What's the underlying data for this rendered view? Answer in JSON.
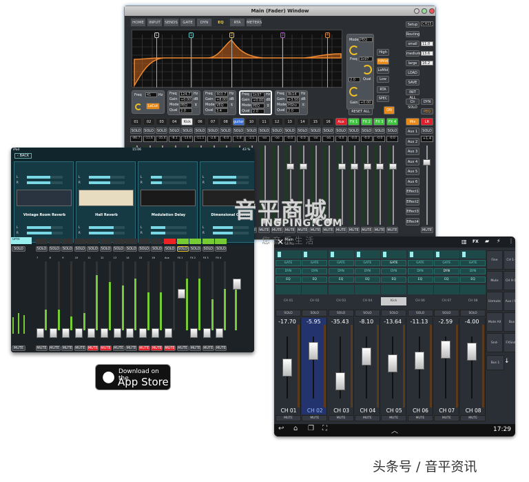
{
  "desktop": {
    "title": "Main (Fader) Window",
    "tabs": [
      "HOME",
      "INPUT",
      "SENDS",
      "GATE",
      "DYN",
      "EQ",
      "RTA",
      "METERS"
    ],
    "active_tab": "EQ",
    "band_markers": [
      "L",
      "1",
      "2",
      "3",
      "4"
    ],
    "band_marker_colors": [
      "#cccccc",
      "#5fc8c8",
      "#e0c040",
      "#b050d0",
      "#e09040"
    ],
    "eq_panel": {
      "mode_label": "Mode",
      "mode": "PEQ",
      "freq_label": "Freq",
      "freq": "1k97",
      "qual_label": "Qual",
      "qual": "2.0",
      "gain_label": "Gain",
      "gain": "+0.00"
    },
    "band_buttons": [
      "High",
      "HiMid",
      "LoMid",
      "Low"
    ],
    "active_band": "HiMid",
    "rta": "RTA",
    "spec": "SPEC",
    "reset_all": "RESET ALL",
    "on": "ON",
    "lowcut": {
      "freq_label": "Freq",
      "freq": "41",
      "unit": "Hz",
      "button": "LoCut"
    },
    "bands": [
      {
        "freq": "124.7",
        "gain": "+0.00",
        "mode": "PEQ",
        "qual": "2.0"
      },
      {
        "freq": "403.7",
        "gain": "+8.00",
        "mode": "VEQ",
        "qual": "3.4"
      },
      {
        "freq": "1k97",
        "gain": "+0.00",
        "mode": "PEQ",
        "qual": "2.0"
      },
      {
        "freq": "8k14",
        "gain": "+3.50",
        "mode": "HShv",
        "qual": "2.0"
      }
    ],
    "band_labels": {
      "freq": "Freq",
      "gain": "Gain",
      "mode": "Mode",
      "qual": "Qual",
      "hz": "Hz",
      "db": "dB",
      "b": "B"
    },
    "setup": {
      "setup": "Setup",
      "ch": "CH15",
      "routing": "Routing",
      "small": "small",
      "small_v": "11.0",
      "medium": "medium",
      "medium_v": "13.6",
      "large": "large",
      "large_v": "16.2",
      "load": "LOAD",
      "save": "SAVE",
      "init": "INIT ALL",
      "clr_solo": "Clr SOLO",
      "dyn": "DYN",
      "peq": "PEQ",
      "mix": "Mix",
      "lr": "LR"
    },
    "channels": [
      {
        "name": "01",
        "value": "-86.7",
        "fader": 0.2
      },
      {
        "name": "02",
        "value": "-11.6",
        "fader": 0.2
      },
      {
        "name": "03",
        "value": "-35.4",
        "fader": 0.2
      },
      {
        "name": "04",
        "value": "-8.1",
        "fader": 0.2
      },
      {
        "name": "Kick",
        "value": "-13.6",
        "fader": 0.2,
        "style": "wht"
      },
      {
        "name": "06",
        "value": "-11.1",
        "fader": 0.2
      },
      {
        "name": "07",
        "value": "-2.6",
        "fader": 0.2
      },
      {
        "name": "08",
        "value": "-4.0",
        "fader": 0.2
      },
      {
        "name": "guitar",
        "value": "-1.8",
        "fader": 0.2,
        "style": "blu"
      },
      {
        "name": "10",
        "value": "-2.1",
        "fader": 0.2
      },
      {
        "name": "11",
        "value": "-oo",
        "fader": 0.0
      },
      {
        "name": "12",
        "value": "-oo",
        "fader": 0.0
      },
      {
        "name": "13",
        "value": "-0.0",
        "fader": 0.75
      },
      {
        "name": "14",
        "value": "-0.0",
        "fader": 0.75
      },
      {
        "name": "15",
        "value": "-oo",
        "fader": 0.0
      },
      {
        "name": "16",
        "value": "-oo",
        "fader": 0.0
      },
      {
        "name": "Aux",
        "value": "-0.0",
        "fader": 0.75,
        "style": "red"
      },
      {
        "name": "FX 1",
        "value": "-0.0",
        "fader": 0.75,
        "style": "grn"
      },
      {
        "name": "FX 2",
        "value": "-0.0",
        "fader": 0.75,
        "style": "grn"
      },
      {
        "name": "FX 3",
        "value": "-0.0",
        "fader": 0.75,
        "style": "grn"
      },
      {
        "name": "FX 4",
        "value": "-0.0",
        "fader": 0.75,
        "style": "grn"
      }
    ],
    "solo": "SOLO",
    "mute": "MUTE",
    "bottom_labels": [
      "FX 2",
      "FX 3",
      "FX 4"
    ],
    "aux_buttons": [
      "Aux 1",
      "Aux 2",
      "Aux 3",
      "Aux 4",
      "Aux 5",
      "Aux 6",
      "Effect1",
      "Effect2",
      "Effect3",
      "Effect4"
    ],
    "lr_value": "+1.4",
    "lr_label": "LR"
  },
  "ipad": {
    "status_left": "iPad",
    "status_time": "15:06",
    "status_battery": "43 %",
    "back": "BACK",
    "effects": [
      "Vintage Room Reverb",
      "Hall Reverb",
      "Modulation Delay",
      "Dimensional Chorus"
    ],
    "meter_l": "L",
    "meter_r": "R",
    "meter_levels": [
      [
        0.65,
        0.65,
        0.68,
        0.7
      ],
      [
        0.6,
        0.6,
        0.7,
        0.7
      ],
      [
        0.3,
        0.3,
        0.4,
        0.4
      ],
      [
        0.65,
        0.65,
        0.55,
        0.55
      ]
    ],
    "group_label": "ums",
    "solo": "SOLO",
    "mute": "MUTE",
    "strip_numbers": [
      "7",
      "8",
      "9",
      "10",
      "11",
      "12",
      "13",
      "14",
      "15",
      "16",
      "Aux",
      "FX 1",
      "FX 2",
      "FX 3",
      "FX 4"
    ],
    "strip_levels": [
      0.3,
      0.3,
      0.2,
      0.25,
      0.8,
      0.7,
      0.65,
      0.75,
      0.55,
      0.55,
      0.0,
      0.75,
      0.75,
      0.45,
      0.6
    ],
    "strip_muted": [
      false,
      false,
      false,
      false,
      true,
      true,
      false,
      false,
      true,
      true,
      true,
      false,
      false,
      false,
      false
    ],
    "mini_levels": [
      0.4,
      0.5,
      0.45
    ],
    "master_level": 0.6
  },
  "android": {
    "title": "Main",
    "subtitle": "LR Mix",
    "fx": "FX",
    "rows": {
      "gate": "GATE",
      "dyn": "DYN",
      "eq": "EQ",
      "solo": "SOLO",
      "mute": "MUTE"
    },
    "channels": [
      {
        "name": "CH 01",
        "label": "CH 01",
        "value": "-17.70",
        "fader": 0.45
      },
      {
        "name": "CH 02",
        "label": "CH 02",
        "value": "-5.95",
        "fader": 0.75,
        "selected": true
      },
      {
        "name": "CH 03",
        "label": "CH 03",
        "value": "-35.43",
        "fader": 0.2
      },
      {
        "name": "CH 04",
        "label": "CH 04",
        "value": "-8.10",
        "fader": 0.65
      },
      {
        "name": "CH 05",
        "label": "Kick",
        "value": "-13.64",
        "fader": 0.53
      },
      {
        "name": "CH 06",
        "label": "CH 06",
        "value": "-11.13",
        "fader": 0.57
      },
      {
        "name": "CH 07",
        "label": "CH 07",
        "value": "-2.59",
        "fader": 0.78
      },
      {
        "name": "CH 08",
        "label": "CH 08",
        "value": "-4.00",
        "fader": 0.74
      }
    ],
    "side_buttons": [
      [
        "Fine",
        "CH 1-8"
      ],
      [
        "Mute Lock",
        "CH 9-16"
      ],
      [
        "Unmute All",
        "Aux / FX"
      ],
      [
        "Mute All",
        "Bus"
      ],
      [
        "Snd->Fader",
        "FXSnd / M"
      ]
    ],
    "bus": "Bus 1",
    "clock": "17:29"
  },
  "appstore": {
    "line1": "Download on the",
    "line2": "App Store"
  },
  "watermark": {
    "brand": "音平商城",
    "url": "INGPING.COM",
    "slogan": "您 音 乐 生 活",
    "footer": "头条号 / 音平资讯"
  }
}
